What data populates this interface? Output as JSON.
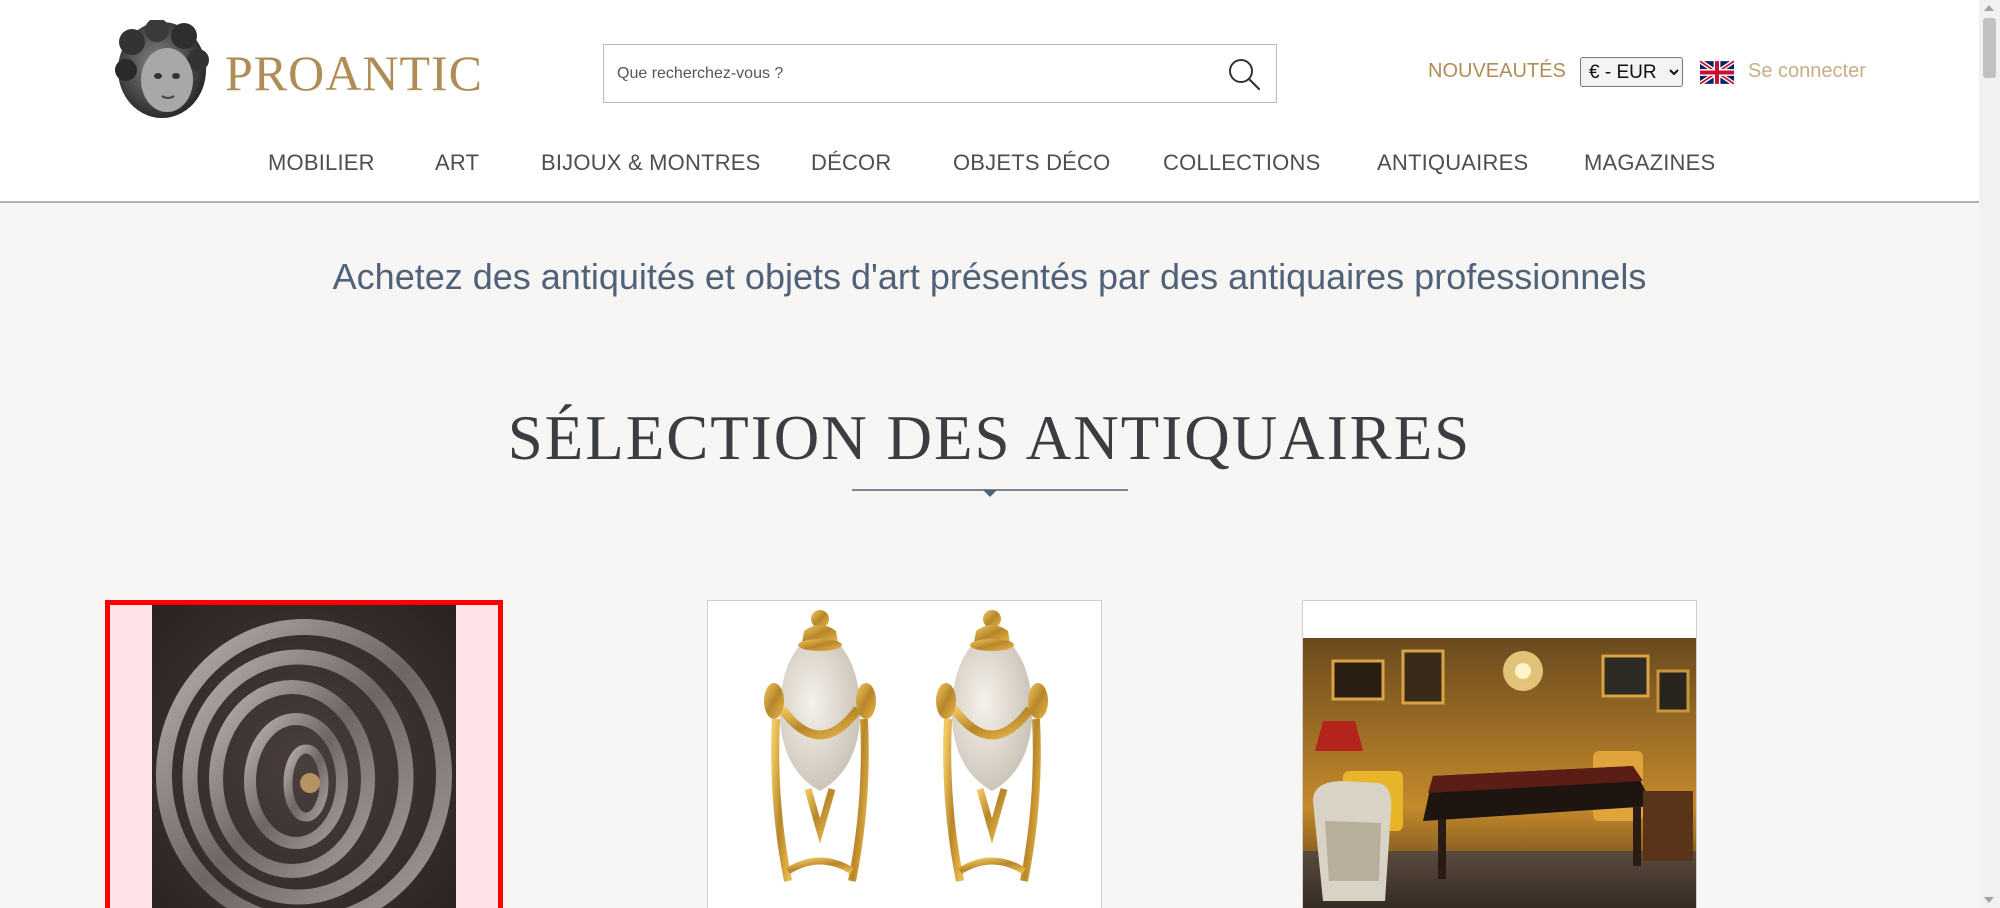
{
  "header": {
    "brand": "PROANTIC",
    "logo_icon": "putto-head-logo",
    "search": {
      "placeholder": "Que recherchez-vous ?",
      "value": "",
      "icon": "search-icon"
    },
    "nouveautes_label": "NOUVEAUTÉS",
    "currency": {
      "selected": "€ - EUR",
      "options": [
        "€ - EUR"
      ]
    },
    "language_icon": "uk-flag-icon",
    "login_label": "Se connecter"
  },
  "nav": {
    "items": [
      {
        "label": "MOBILIER"
      },
      {
        "label": "ART"
      },
      {
        "label": "BIJOUX & MONTRES"
      },
      {
        "label": "DÉCOR"
      },
      {
        "label": "OBJETS DÉCO"
      },
      {
        "label": "COLLECTIONS"
      },
      {
        "label": "ANTIQUAIRES"
      },
      {
        "label": "MAGAZINES"
      }
    ]
  },
  "main": {
    "tagline": "Achetez des antiquités et objets d'art présentés par des antiquaires professionnels",
    "section_title": "SÉLECTION DES ANTIQUAIRES",
    "cards": [
      {
        "image": "metal-ring-sculpture",
        "selected": true
      },
      {
        "image": "alabaster-ormolu-vases-pair",
        "selected": false
      },
      {
        "image": "antique-shop-interior",
        "selected": false
      }
    ]
  },
  "colors": {
    "brand_gold": "#b08d57",
    "nav_text": "#4a4f55",
    "tagline_blue": "#4f627a",
    "selection_outline": "#ff0000"
  }
}
